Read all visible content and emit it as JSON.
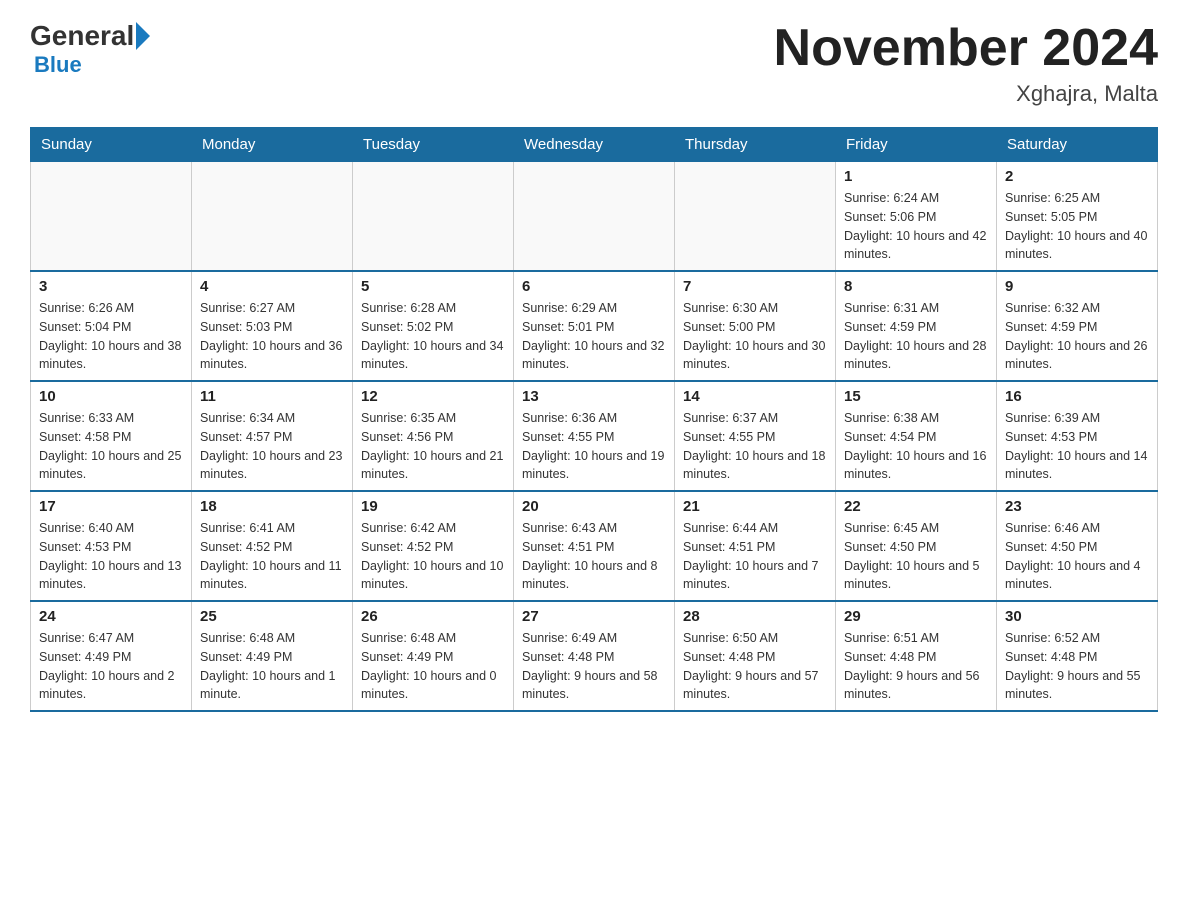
{
  "header": {
    "logo_general": "General",
    "logo_blue": "Blue",
    "title": "November 2024",
    "location": "Xghajra, Malta"
  },
  "calendar": {
    "days_of_week": [
      "Sunday",
      "Monday",
      "Tuesday",
      "Wednesday",
      "Thursday",
      "Friday",
      "Saturday"
    ],
    "weeks": [
      [
        {
          "day": "",
          "info": ""
        },
        {
          "day": "",
          "info": ""
        },
        {
          "day": "",
          "info": ""
        },
        {
          "day": "",
          "info": ""
        },
        {
          "day": "",
          "info": ""
        },
        {
          "day": "1",
          "info": "Sunrise: 6:24 AM\nSunset: 5:06 PM\nDaylight: 10 hours and 42 minutes."
        },
        {
          "day": "2",
          "info": "Sunrise: 6:25 AM\nSunset: 5:05 PM\nDaylight: 10 hours and 40 minutes."
        }
      ],
      [
        {
          "day": "3",
          "info": "Sunrise: 6:26 AM\nSunset: 5:04 PM\nDaylight: 10 hours and 38 minutes."
        },
        {
          "day": "4",
          "info": "Sunrise: 6:27 AM\nSunset: 5:03 PM\nDaylight: 10 hours and 36 minutes."
        },
        {
          "day": "5",
          "info": "Sunrise: 6:28 AM\nSunset: 5:02 PM\nDaylight: 10 hours and 34 minutes."
        },
        {
          "day": "6",
          "info": "Sunrise: 6:29 AM\nSunset: 5:01 PM\nDaylight: 10 hours and 32 minutes."
        },
        {
          "day": "7",
          "info": "Sunrise: 6:30 AM\nSunset: 5:00 PM\nDaylight: 10 hours and 30 minutes."
        },
        {
          "day": "8",
          "info": "Sunrise: 6:31 AM\nSunset: 4:59 PM\nDaylight: 10 hours and 28 minutes."
        },
        {
          "day": "9",
          "info": "Sunrise: 6:32 AM\nSunset: 4:59 PM\nDaylight: 10 hours and 26 minutes."
        }
      ],
      [
        {
          "day": "10",
          "info": "Sunrise: 6:33 AM\nSunset: 4:58 PM\nDaylight: 10 hours and 25 minutes."
        },
        {
          "day": "11",
          "info": "Sunrise: 6:34 AM\nSunset: 4:57 PM\nDaylight: 10 hours and 23 minutes."
        },
        {
          "day": "12",
          "info": "Sunrise: 6:35 AM\nSunset: 4:56 PM\nDaylight: 10 hours and 21 minutes."
        },
        {
          "day": "13",
          "info": "Sunrise: 6:36 AM\nSunset: 4:55 PM\nDaylight: 10 hours and 19 minutes."
        },
        {
          "day": "14",
          "info": "Sunrise: 6:37 AM\nSunset: 4:55 PM\nDaylight: 10 hours and 18 minutes."
        },
        {
          "day": "15",
          "info": "Sunrise: 6:38 AM\nSunset: 4:54 PM\nDaylight: 10 hours and 16 minutes."
        },
        {
          "day": "16",
          "info": "Sunrise: 6:39 AM\nSunset: 4:53 PM\nDaylight: 10 hours and 14 minutes."
        }
      ],
      [
        {
          "day": "17",
          "info": "Sunrise: 6:40 AM\nSunset: 4:53 PM\nDaylight: 10 hours and 13 minutes."
        },
        {
          "day": "18",
          "info": "Sunrise: 6:41 AM\nSunset: 4:52 PM\nDaylight: 10 hours and 11 minutes."
        },
        {
          "day": "19",
          "info": "Sunrise: 6:42 AM\nSunset: 4:52 PM\nDaylight: 10 hours and 10 minutes."
        },
        {
          "day": "20",
          "info": "Sunrise: 6:43 AM\nSunset: 4:51 PM\nDaylight: 10 hours and 8 minutes."
        },
        {
          "day": "21",
          "info": "Sunrise: 6:44 AM\nSunset: 4:51 PM\nDaylight: 10 hours and 7 minutes."
        },
        {
          "day": "22",
          "info": "Sunrise: 6:45 AM\nSunset: 4:50 PM\nDaylight: 10 hours and 5 minutes."
        },
        {
          "day": "23",
          "info": "Sunrise: 6:46 AM\nSunset: 4:50 PM\nDaylight: 10 hours and 4 minutes."
        }
      ],
      [
        {
          "day": "24",
          "info": "Sunrise: 6:47 AM\nSunset: 4:49 PM\nDaylight: 10 hours and 2 minutes."
        },
        {
          "day": "25",
          "info": "Sunrise: 6:48 AM\nSunset: 4:49 PM\nDaylight: 10 hours and 1 minute."
        },
        {
          "day": "26",
          "info": "Sunrise: 6:48 AM\nSunset: 4:49 PM\nDaylight: 10 hours and 0 minutes."
        },
        {
          "day": "27",
          "info": "Sunrise: 6:49 AM\nSunset: 4:48 PM\nDaylight: 9 hours and 58 minutes."
        },
        {
          "day": "28",
          "info": "Sunrise: 6:50 AM\nSunset: 4:48 PM\nDaylight: 9 hours and 57 minutes."
        },
        {
          "day": "29",
          "info": "Sunrise: 6:51 AM\nSunset: 4:48 PM\nDaylight: 9 hours and 56 minutes."
        },
        {
          "day": "30",
          "info": "Sunrise: 6:52 AM\nSunset: 4:48 PM\nDaylight: 9 hours and 55 minutes."
        }
      ]
    ]
  }
}
